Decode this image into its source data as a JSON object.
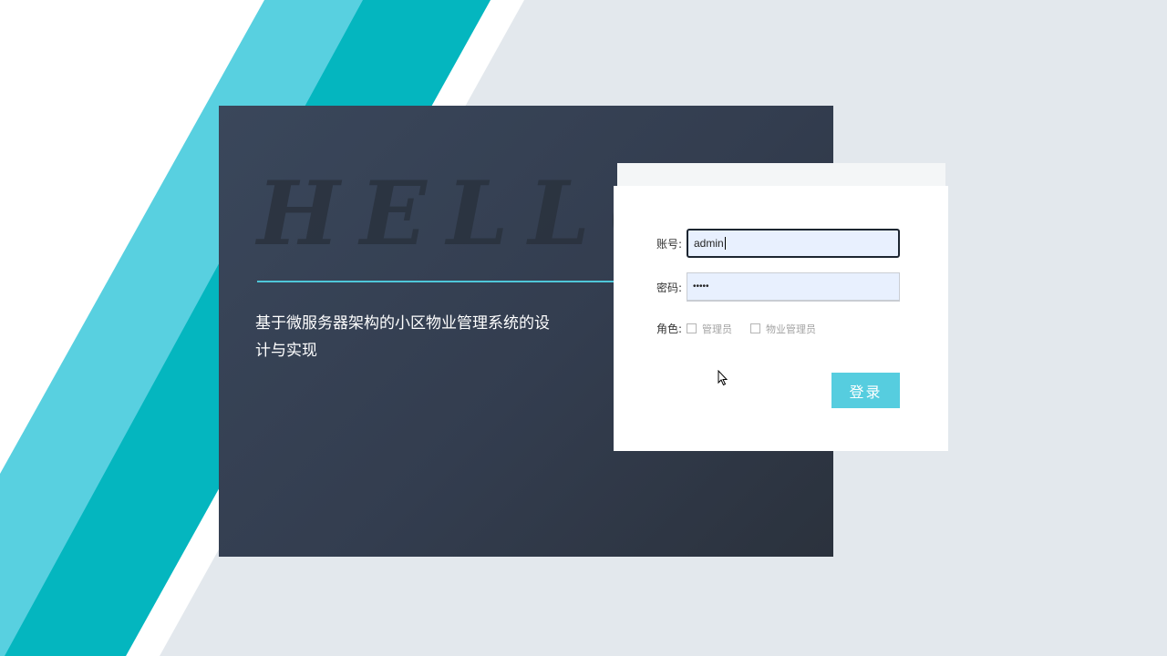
{
  "brand": {
    "hello_text": "HELLO",
    "system_title": "基于微服务器架构的小区物业管理系统的设计与实现"
  },
  "login_form": {
    "account_label": "账号:",
    "account_value": "admin",
    "password_label": "密码:",
    "password_value": "•••••",
    "role_label": "角色:",
    "roles": [
      "管理员",
      "物业管理员"
    ],
    "submit_label": "登录"
  },
  "colors": {
    "accent": "#56cddf",
    "teal_dark": "#04b6bf",
    "cyan_light": "#58d0e0",
    "panel_dark": "#333d4f"
  },
  "icons": {
    "cursor": "mouse-pointer-icon",
    "checkbox": "checkbox-unchecked-icon"
  }
}
